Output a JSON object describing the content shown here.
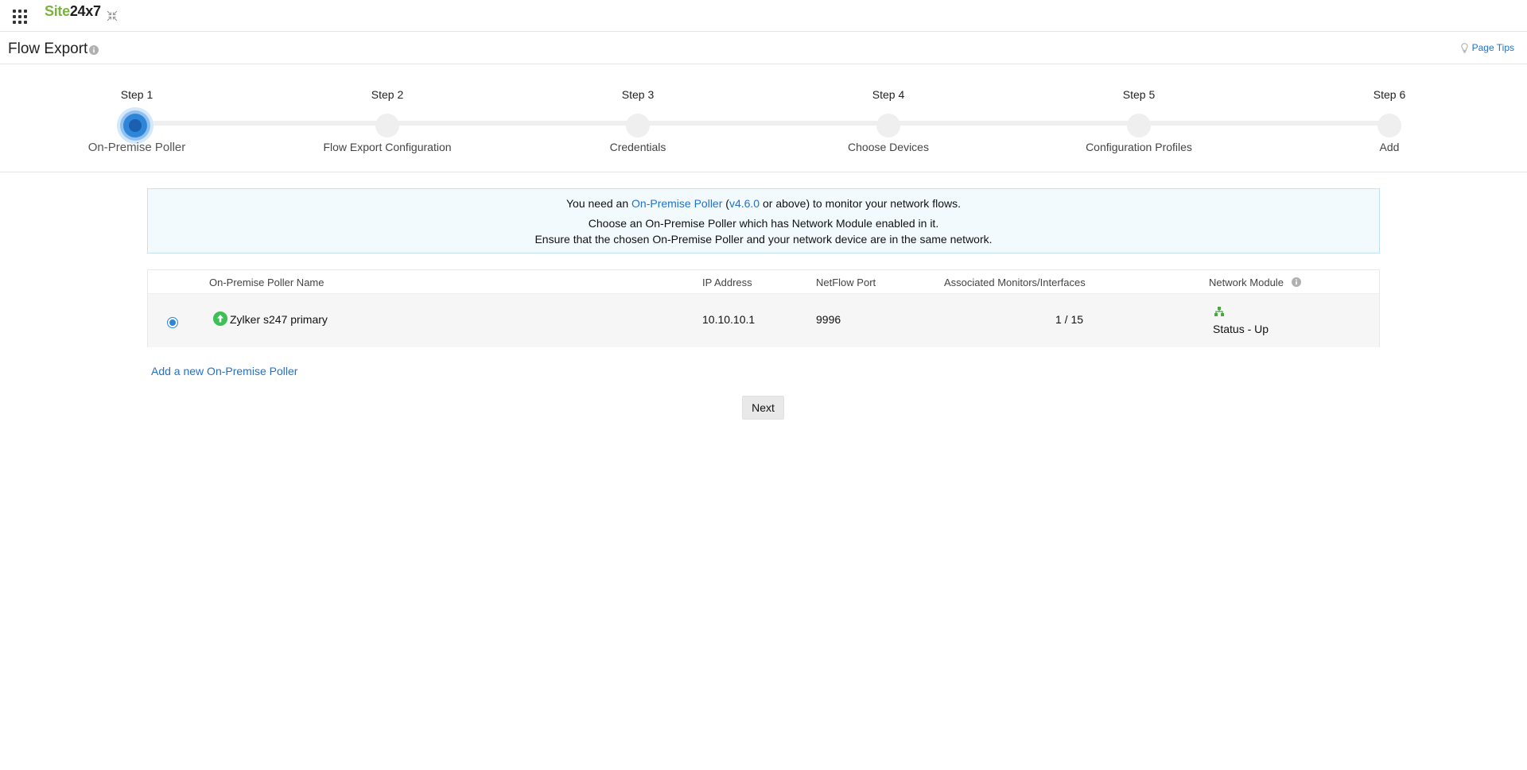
{
  "brand": {
    "part1": "Site",
    "part2": "24x7"
  },
  "header": {
    "title": "Flow Export",
    "page_tips": "Page Tips"
  },
  "steps": [
    {
      "number": "Step 1",
      "label": "On-Premise Poller",
      "active": true
    },
    {
      "number": "Step 2",
      "label": "Flow Export Configuration",
      "active": false
    },
    {
      "number": "Step 3",
      "label": "Credentials",
      "active": false
    },
    {
      "number": "Step 4",
      "label": "Choose Devices",
      "active": false
    },
    {
      "number": "Step 5",
      "label": "Configuration Profiles",
      "active": false
    },
    {
      "number": "Step 6",
      "label": "Add",
      "active": false
    }
  ],
  "info": {
    "line1_prefix": "You need an ",
    "line1_link1": "On-Premise Poller",
    "line1_mid": " (",
    "line1_link2": "v4.6.0",
    "line1_suffix": " or above) to monitor your network flows.",
    "line2": "Choose an On-Premise Poller which has Network Module enabled in it.",
    "line3": "Ensure that the chosen On-Premise Poller and your network device are in the same network."
  },
  "table": {
    "columns": {
      "name": "On-Premise Poller Name",
      "ip": "IP Address",
      "port": "NetFlow Port",
      "monitors": "Associated Monitors/Interfaces",
      "module": "Network Module"
    },
    "rows": [
      {
        "name": "Zylker s247 primary",
        "ip": "10.10.10.1",
        "port": "9996",
        "monitors": "1 / 15",
        "module_status": "Status - Up",
        "selected": true
      }
    ]
  },
  "add_link": "Add a new On-Premise Poller",
  "next_label": "Next",
  "colors": {
    "accent": "#2272c8",
    "brand_green": "#7cb33c",
    "status_up": "#3fbf57"
  }
}
